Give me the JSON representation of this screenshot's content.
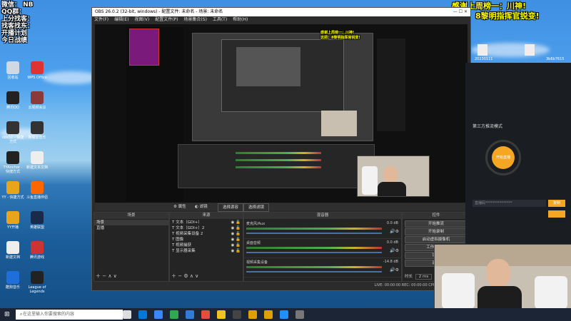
{
  "overlay": {
    "top_left_lines": [
      "微信： NB",
      "鱼皮玩单",
      "QQ群：",
      "24908185",
      "上分找客：",
      "伊拉",
      "龙虾!",
      "找客找东：",
      "龙虾!",
      "开播计划",
      "今日战绩"
    ],
    "thanks_line1": "感谢上周榜一：川神!",
    "thanks_line2": "这把：8黎明指挥官锐变!",
    "mini_thanks": [
      "感谢上周榜一：川神!",
      "这把：8黎明指挥官锐变!"
    ]
  },
  "desktop_icons": [
    {
      "label": "回收站",
      "icon": "recycle-bin-icon",
      "color": "#cfd8e3"
    },
    {
      "label": "WPS Office",
      "icon": "wps-icon",
      "color": "#d33"
    },
    {
      "label": "腾讯QQ",
      "icon": "qq-icon",
      "color": "#222"
    },
    {
      "label": "云视频会议",
      "icon": "rar-icon",
      "color": "#8b3a3a"
    },
    {
      "label": "obs32 - 快捷方式",
      "icon": "obs-icon",
      "color": "#333"
    },
    {
      "label": "网易云音乐",
      "icon": "music-icon",
      "color": "#333"
    },
    {
      "label": "TYAnchor - 快捷方式",
      "icon": "ty-icon",
      "color": "#222"
    },
    {
      "label": "新建文本文档",
      "icon": "doc-icon",
      "color": "#eee"
    },
    {
      "label": "YY - 快捷方式",
      "icon": "yy-icon",
      "color": "#e8a51b"
    },
    {
      "label": "斗鱼直播伴侣",
      "icon": "douyu-icon",
      "color": "#f60"
    },
    {
      "label": "YY开播",
      "icon": "yykb-icon",
      "color": "#e8a51b"
    },
    {
      "label": "英雄联盟",
      "icon": "lol-icon",
      "color": "#1a2a4a"
    },
    {
      "label": "新建文档",
      "icon": "file-icon",
      "color": "#eee"
    },
    {
      "label": "腾讯游戏",
      "icon": "game-icon",
      "color": "#c33"
    },
    {
      "label": "酷狗音乐",
      "icon": "kugou-icon",
      "color": "#1e6fd9"
    },
    {
      "label": "League of Legends",
      "icon": "league-icon",
      "color": "#222"
    }
  ],
  "obs": {
    "title": "OBS 26.0.2 (32-bit, windows) - 配置文件: 未命名 - 场景: 未命名",
    "menu": [
      "文件(F)",
      "编辑(E)",
      "视图(V)",
      "配置文件(P)",
      "场景集合(S)",
      "工具(T)",
      "帮助(H)"
    ],
    "toolbar": [
      "属性",
      "滤镜",
      "选择源容",
      "选择滤镜"
    ],
    "docks": {
      "scenes": "场景",
      "sources": "来源",
      "mixer": "混音器",
      "transitions": "转场",
      "controls": "控件"
    },
    "scenes": [
      "场景",
      "直播"
    ],
    "sources": [
      "文本（GDI+）",
      "文本（GDI+）2",
      "视频采集设备 2",
      "图像",
      "视频捕获",
      "显示器采集"
    ],
    "mixer": [
      {
        "name": "麦克风/Aux",
        "db": "0.0 dB"
      },
      {
        "name": "桌面音频",
        "db": "0.0 dB"
      },
      {
        "name": "视频采集设备",
        "db": "-14.8 dB"
      }
    ],
    "controls": [
      "开始推流",
      "开始录制",
      "启动虚拟摄像机",
      "工作室模式",
      "设置",
      "退出"
    ],
    "transition": {
      "name": "淡出",
      "duration_label": "时长",
      "duration": "2 ms"
    },
    "status": "LIVE: 00:00:00   REC: 00:00:00   CPU: 8.1%, 30.00 fps"
  },
  "right_panel": {
    "mode_label": "第三方推流模式",
    "start_label": "开始直播",
    "input_hint": "直播码***************",
    "copy_label": "复制"
  },
  "file_icons": [
    {
      "label": "20230111"
    },
    {
      "label": "20230115"
    },
    {
      "label": "新建文本"
    },
    {
      "label": "3b6b7615"
    }
  ],
  "taskbar": {
    "search_placeholder": "在这里输入你要搜索的内容"
  }
}
